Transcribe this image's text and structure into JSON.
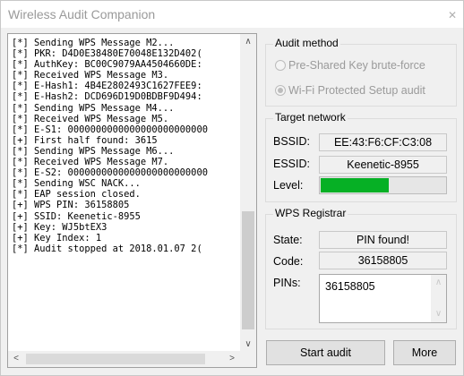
{
  "window": {
    "title": "Wireless Audit Companion",
    "close_glyph": "✕"
  },
  "log": {
    "lines": [
      "[*] Sending WPS Message M2...",
      "[*] PKR: D4D0E38480E70048E132D402(",
      "[*] AuthKey: BC00C9079AA4504660DE:",
      "[*] Received WPS Message M3.",
      "[*] E-Hash1: 4B4E2802493C1627FEE9:",
      "[*] E-Hash2: DCD696D19D0BDBF9D494:",
      "[*] Sending WPS Message M4...",
      "[*] Received WPS Message M5.",
      "[*] E-S1: 0000000000000000000000000",
      "[+] First half found: 3615",
      "[*] Sending WPS Message M6...",
      "[*] Received WPS Message M7.",
      "[*] E-S2: 0000000000000000000000000",
      "[*] Sending WSC NACK...",
      "[*] EAP session closed.",
      "[+] WPS PIN: 36158805",
      "[+] SSID: Keenetic-8955",
      "[+] Key: WJ5btEX3",
      "[+] Key Index: 1",
      "[*] Audit stopped at 2018.01.07 2("
    ]
  },
  "audit_method": {
    "label": "Audit method",
    "options": [
      {
        "label": "Pre-Shared Key brute-force",
        "checked": false
      },
      {
        "label": "Wi-Fi Protected Setup audit",
        "checked": true
      }
    ]
  },
  "target_network": {
    "label": "Target network",
    "bssid_label": "BSSID:",
    "bssid": "EE:43:F6:CF:C3:08",
    "essid_label": "ESSID:",
    "essid": "Keenetic-8955",
    "level_label": "Level:",
    "level_fraction": 0.55,
    "level_color": "#06b025"
  },
  "wps_registrar": {
    "label": "WPS Registrar",
    "state_label": "State:",
    "state": "PIN found!",
    "code_label": "Code:",
    "code": "36158805",
    "pins_label": "PINs:",
    "pins": "36158805"
  },
  "buttons": {
    "start": "Start audit",
    "more": "More"
  }
}
